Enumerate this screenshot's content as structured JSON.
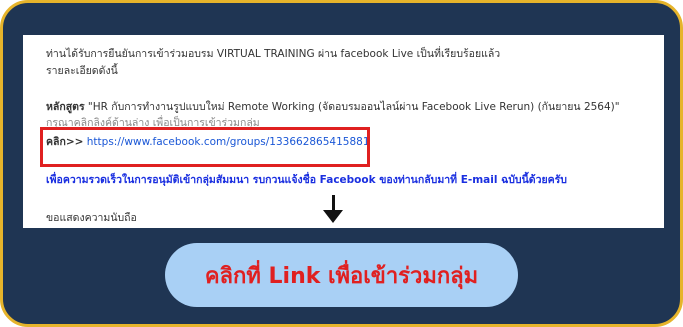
{
  "email": {
    "line1": "ท่านได้รับการยืนยันการเข้าร่วมอบรม VIRTUAL TRAINING ผ่าน facebook Live เป็นที่เรียบร้อยแล้ว",
    "line2": "รายละเอียดดังนี้",
    "course_label": "หลักสูตร",
    "course_text": " \"HR กับการทำงานรูปแบบใหม่ Remote Working (จัดอบรมออนไลน์ผ่าน Facebook Live Rerun) (กันยายน 2564)\"",
    "partial_line": "กรุณาคลิกลิงค์ด้านล่าง เพื่อเป็นการเข้าร่วมกลุ่ม",
    "click_label": "คลิก>>",
    "link_url": " https://www.facebook.com/groups/133662865415881",
    "notice": "เพื่อความรวดเร็วในการอนุมัติเข้ากลุ่มสัมมนา รบกวนแจ้งชื่อ Facebook ของท่านกลับมาที่ E-mail ฉบับนี้ด้วยครับ",
    "closing": "ขอแสดงความนับถือ"
  },
  "cta": {
    "label": "คลิกที่ Link เพื่อเข้าร่วมกลุ่ม"
  },
  "colors": {
    "frame_background": "#1f3553",
    "frame_border": "#e6b42b",
    "highlight_border": "#e02020",
    "link": "#1a57d6",
    "cta_background": "#a9d0f5",
    "cta_text": "#e02020"
  },
  "icons": {
    "arrow": "arrow-down-icon"
  }
}
